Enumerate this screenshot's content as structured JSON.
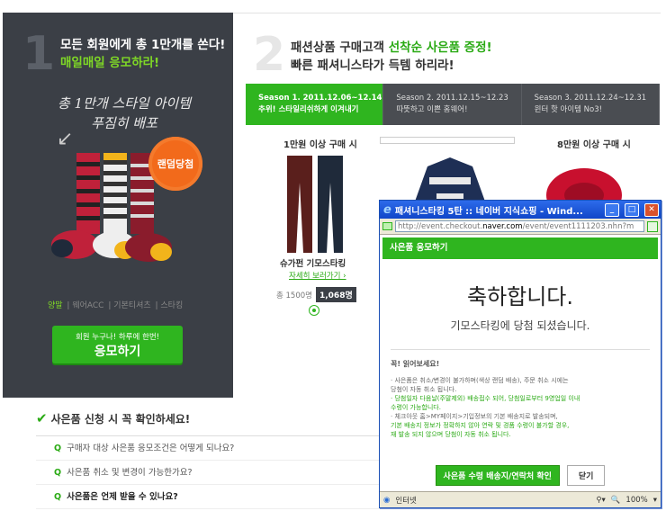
{
  "left": {
    "number": "1",
    "headline1": "모든 회원에게 총 1만개를 쏜다!",
    "headline2": "매일매일 응모하라!",
    "hand_text": "총 1만개 스타일 아이템 푸짐히 배포",
    "badge": "랜덤당첨",
    "categories": [
      "양말",
      "웨어ACC",
      "기본티셔츠",
      "스타킹"
    ],
    "apply_small": "회원 누구나! 하루에 한번!",
    "apply_label": "응모하기"
  },
  "right": {
    "number": "2",
    "head1_a": "패션상품 구매고객 ",
    "head1_b": "선착순 사은품 증정!",
    "head2": "빠른 패셔니스타가 득템 하리라!",
    "tabs": [
      {
        "line1": "Season 1. 2011.12.06~12.14",
        "line2": "추위! 스타일리쉬하게 이겨내기"
      },
      {
        "line1": "Season 2. 2011.12.15~12.23",
        "line2": "따뜻하고 이쁜 홈웨어!"
      },
      {
        "line1": "Season 3. 2011.12.24~12.31",
        "line2": "윈터 핫 아이템 No3!"
      }
    ],
    "col1": "1만원 이상 구매 시",
    "col3": "8만원 이상 구매 시",
    "product_name": "슈가펀 기모스타킹",
    "product_link": "자세히 보러가기 ›",
    "count_label": "총 1500명",
    "count_value": "1,068명"
  },
  "faq": {
    "title": "사은품 신청 시 꼭 확인하세요!",
    "items": [
      "구매자 대상 사은품 응모조건은 어떻게 되나요?",
      "사은품 취소 및 변경이 가능한가요?",
      "사은품은 언제 받을 수 있나요?"
    ]
  },
  "popup": {
    "title": "패셔니스타킹 5탄 :: 네이버 지식쇼핑 - Wind...",
    "url_a": "http://event.checkout.",
    "url_b": "naver.com",
    "url_c": "/event/event1111203.nhn?m",
    "green_label": "사은품 응모하기",
    "congrats": "축하합니다.",
    "sub": "기모스타킹에 당첨 되셨습니다.",
    "notice_title": "꼭! 읽어보세요!",
    "notice_lines": [
      "· 사은품은 취소/변경이 불가하며(색상 랜덤 배송), 주문 취소 시에는",
      "  당첨이 자동 취소 됩니다.",
      "· 당첨일자 다음날(주말제외) 배송접수 되어, 당첨일로부터 9영업일 이내",
      "  수령이 가능합니다.",
      "· 체크아웃 홈>MY페이지>기입정보의 기본 배송지로 발송되며,",
      "  기본 배송지 정보가 정확하지 않아 연락 및 경품 수령이 불가할 경우,",
      "  재 발송 되지 않으며 당첨이 자동 취소 됩니다."
    ],
    "btn_confirm": "사은품 수령 배송지/연락처 확인",
    "btn_close": "닫기",
    "status_zone": "인터넷",
    "zoom": "100%"
  }
}
